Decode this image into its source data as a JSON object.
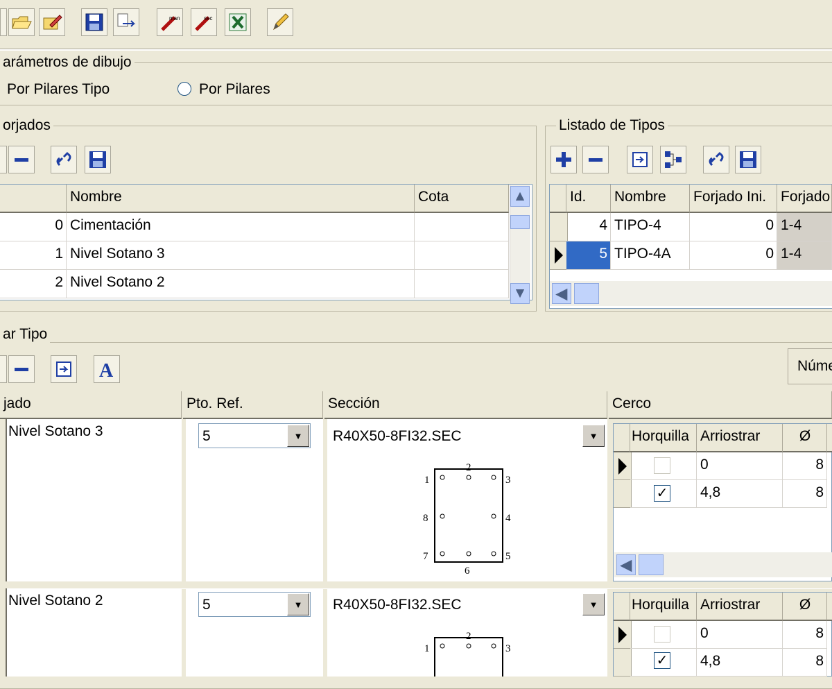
{
  "toolbar": {
    "buttons": [
      "new-icon",
      "open-folder-icon",
      "edit-icon",
      "save-icon",
      "export-icon",
      "wand-man-icon",
      "wand-sec-icon",
      "excel-icon",
      "pencil-icon"
    ]
  },
  "params": {
    "title": "arámetros de dibujo",
    "option_tipo": "Por Pilares Tipo",
    "option_pilares": "Por Pilares"
  },
  "forjados": {
    "title": "orjados",
    "columns": [
      "Nombre",
      "Cota"
    ],
    "rows": [
      {
        "n": "0",
        "nombre": "Cimentación",
        "cota": ""
      },
      {
        "n": "1",
        "nombre": "Nivel Sotano 3",
        "cota": ""
      },
      {
        "n": "2",
        "nombre": "Nivel Sotano 2",
        "cota": ""
      }
    ]
  },
  "tipos": {
    "title": "Listado de Tipos",
    "columns": [
      "Id.",
      "Nombre",
      "Forjado Ini.",
      "Forjado"
    ],
    "rows": [
      {
        "id": "4",
        "nombre": "TIPO-4",
        "ini": "0",
        "forjado": "1-4"
      },
      {
        "id": "5",
        "nombre": "TIPO-4A",
        "ini": "0",
        "forjado": "1-4"
      }
    ]
  },
  "editar": {
    "title": "ar Tipo",
    "numero_label": "Núme",
    "columns": {
      "forjado": "jado",
      "ptoref": "Pto. Ref.",
      "seccion": "Sección",
      "cerco": "Cerco"
    },
    "cerco_columns": [
      "Horquilla",
      "Arriostrar",
      "Ø"
    ],
    "rows": [
      {
        "forjado": "Nivel Sotano 3",
        "ptoref": "5",
        "seccion": "R40X50-8FI32.SEC",
        "point_labels": [
          "1",
          "2",
          "3",
          "4",
          "5",
          "6",
          "7",
          "8"
        ],
        "cerco": [
          {
            "horquilla": false,
            "arriostrar": "0",
            "diam": "8"
          },
          {
            "horquilla": true,
            "arriostrar": "4,8",
            "diam": "8"
          }
        ]
      },
      {
        "forjado": "Nivel Sotano 2",
        "ptoref": "5",
        "seccion": "R40X50-8FI32.SEC",
        "point_labels": [
          "1",
          "2",
          "3"
        ],
        "cerco": [
          {
            "horquilla": false,
            "arriostrar": "0",
            "diam": "8"
          },
          {
            "horquilla": true,
            "arriostrar": "4,8",
            "diam": "8"
          }
        ]
      }
    ]
  }
}
